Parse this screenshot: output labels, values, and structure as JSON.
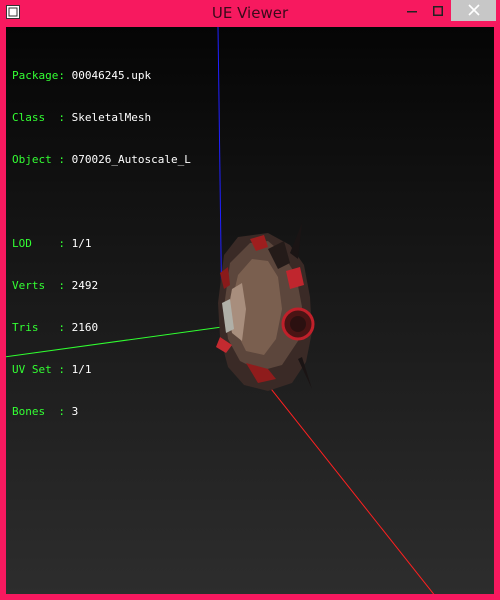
{
  "window": {
    "title": "UE Viewer",
    "frame_color": "#f7195f"
  },
  "info": {
    "package": {
      "label": "Package:",
      "value": "00046245.upk"
    },
    "class": {
      "label": "Class  :",
      "value": "SkeletalMesh"
    },
    "object": {
      "label": "Object :",
      "value": "070026_Autoscale_L"
    },
    "lod": {
      "label": "LOD    :",
      "value": "1/1"
    },
    "verts": {
      "label": "Verts  :",
      "value": "2492"
    },
    "tris": {
      "label": "Tris   :",
      "value": "2160"
    },
    "uvset": {
      "label": "UV Set :",
      "value": "1/1"
    },
    "bones": {
      "label": "Bones  :",
      "value": "3"
    }
  },
  "colors": {
    "label": "#33ff33",
    "value": "#ffffff",
    "axis_x": "#ff2020",
    "axis_y": "#30ff30",
    "axis_z": "#2020ff"
  },
  "icons": [
    "app-icon",
    "minimize-icon",
    "maximize-icon",
    "close-icon"
  ]
}
